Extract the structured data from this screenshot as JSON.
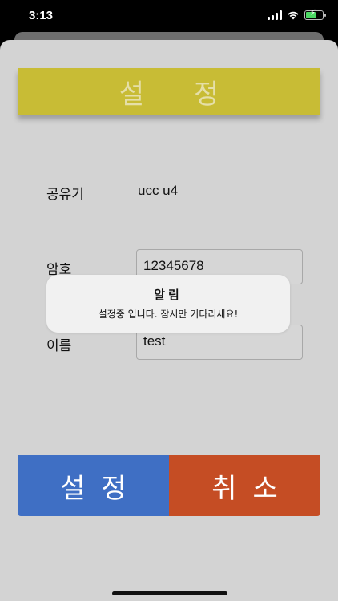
{
  "status": {
    "time": "3:13",
    "battery_color": "#4cd964"
  },
  "header": {
    "title": "설정"
  },
  "form": {
    "router_label": "공유기",
    "router_value": "ucc u4",
    "password_label": "암호",
    "password_value": "12345678",
    "name_label": "이름",
    "name_value": "test"
  },
  "buttons": {
    "set_label": "설정",
    "cancel_label": "취소"
  },
  "alert": {
    "title": "알림",
    "message": "설정중 입니다. 잠시만 기다리세요!"
  },
  "colors": {
    "header_bg": "#c8bc35",
    "set_button": "#3f6fc4",
    "cancel_button": "#c54d24",
    "background": "#d3d3d3"
  }
}
